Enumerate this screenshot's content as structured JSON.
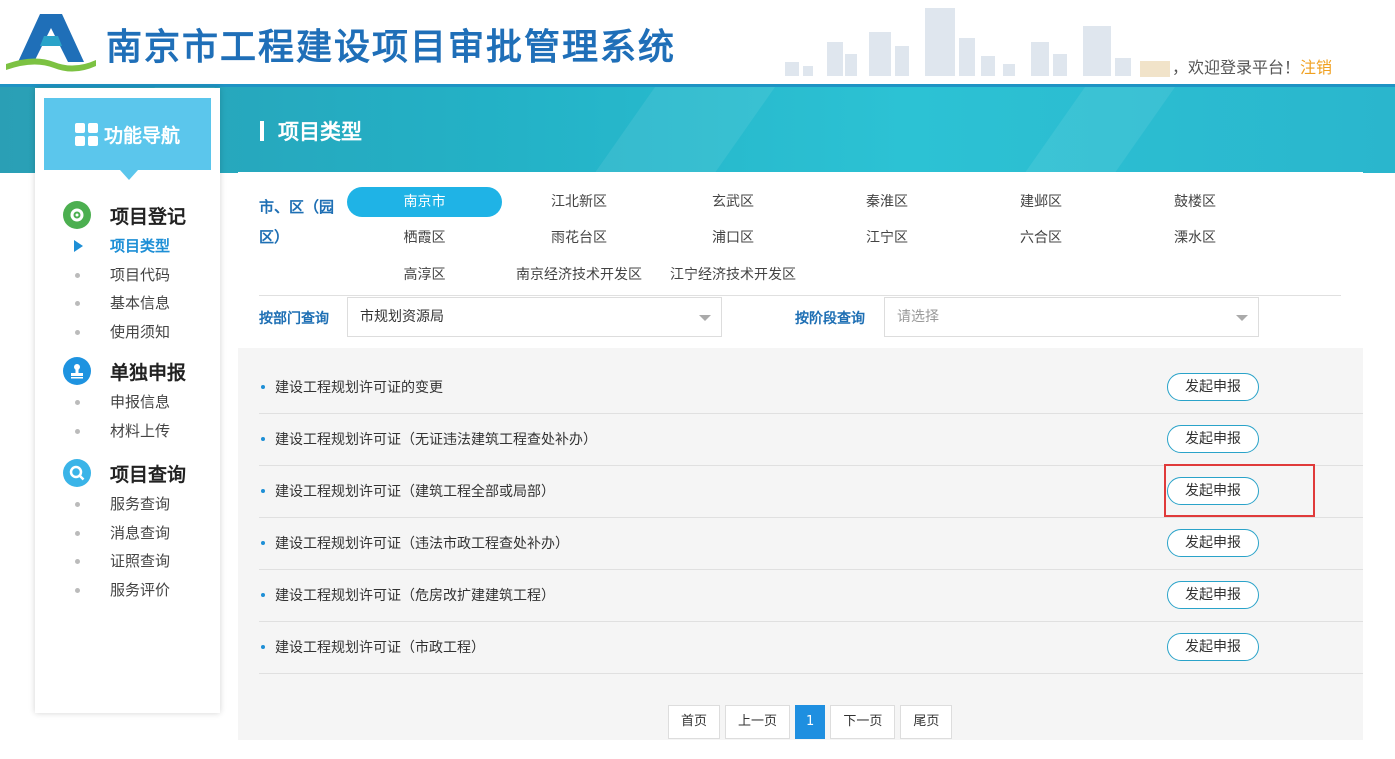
{
  "header": {
    "title": "南京市工程建设项目审批管理系统",
    "welcome": "，欢迎登录平台！",
    "logout": "注销"
  },
  "sidebar": {
    "nav_title": "功能导航",
    "groups": [
      {
        "title": "项目登记",
        "icon": "gear-icon",
        "items": [
          {
            "label": "项目类型",
            "active": true
          },
          {
            "label": "项目代码"
          },
          {
            "label": "基本信息"
          },
          {
            "label": "使用须知"
          }
        ]
      },
      {
        "title": "单独申报",
        "icon": "stamp-icon",
        "items": [
          {
            "label": "申报信息"
          },
          {
            "label": "材料上传"
          }
        ]
      },
      {
        "title": "项目查询",
        "icon": "search-icon",
        "items": [
          {
            "label": "服务查询"
          },
          {
            "label": "消息查询"
          },
          {
            "label": "证照查询"
          },
          {
            "label": "服务评价"
          }
        ]
      }
    ]
  },
  "page_title": "项目类型",
  "filters": {
    "district_label": "市、区（园区）",
    "districts": [
      "南京市",
      "江北新区",
      "玄武区",
      "秦淮区",
      "建邺区",
      "鼓楼区",
      "栖霞区",
      "雨花台区",
      "浦口区",
      "江宁区",
      "六合区",
      "溧水区",
      "高淳区",
      "南京经济技术开发区",
      "江宁经济技术开发区"
    ],
    "selected_district": "南京市",
    "dept_label": "按部门查询",
    "dept_value": "市规划资源局",
    "stage_label": "按阶段查询",
    "stage_placeholder": "请选择"
  },
  "projects": [
    {
      "name": "建设工程规划许可证的变更",
      "action": "发起申报"
    },
    {
      "name": "建设工程规划许可证（无证违法建筑工程查处补办）",
      "action": "发起申报"
    },
    {
      "name": "建设工程规划许可证（建筑工程全部或局部）",
      "action": "发起申报"
    },
    {
      "name": "建设工程规划许可证（违法市政工程查处补办）",
      "action": "发起申报"
    },
    {
      "name": "建设工程规划许可证（危房改扩建建筑工程）",
      "action": "发起申报"
    },
    {
      "name": "建设工程规划许可证（市政工程）",
      "action": "发起申报"
    }
  ],
  "pagination": {
    "first": "首页",
    "prev": "上一页",
    "current": "1",
    "next": "下一页",
    "last": "尾页"
  },
  "colors": {
    "brand_blue": "#1f6fb8",
    "banner": "#23b1c6",
    "highlight": "#e03a3a",
    "accent": "#1fb3e6"
  }
}
